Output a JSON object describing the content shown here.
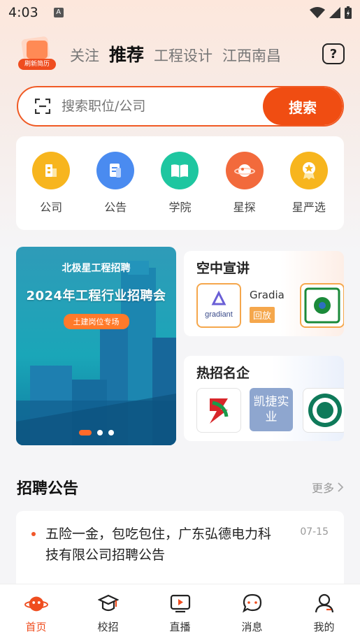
{
  "status_bar": {
    "time": "4:03",
    "a_icon": "A"
  },
  "header": {
    "badge_label": "刷新简历",
    "tabs": [
      "关注",
      "推荐",
      "工程设计",
      "江西南昌"
    ],
    "active_tab_index": 1,
    "help_icon": "?"
  },
  "search": {
    "placeholder": "搜索职位/公司",
    "button_label": "搜索"
  },
  "quick_links": [
    {
      "label": "公司",
      "icon": "building-icon",
      "color": "#f7b51e"
    },
    {
      "label": "公告",
      "icon": "notice-icon",
      "color": "#4a8bf0"
    },
    {
      "label": "学院",
      "icon": "book-icon",
      "color": "#1ec6a0"
    },
    {
      "label": "星探",
      "icon": "planet-icon",
      "color": "#f26a3c"
    },
    {
      "label": "星严选",
      "icon": "award-icon",
      "color": "#f7b51e"
    }
  ],
  "banner": {
    "brand": "北极星工程招聘",
    "title": "2024年工程行业招聘会",
    "tag": "土建岗位专场",
    "active_dot": 0,
    "dot_count": 3
  },
  "live_talk": {
    "title": "空中宣讲",
    "company_name": "Gradia",
    "status_tag": "回放",
    "logo_text": "gradiant"
  },
  "hot_companies": {
    "title": "热招名企",
    "kaijie_logo": "凯捷实业"
  },
  "announcements": {
    "title": "招聘公告",
    "more_label": "更多",
    "items": [
      {
        "text": "五险一金，包吃包住，广东弘德电力科技有限公司招聘公告",
        "date": "07-15"
      }
    ]
  },
  "bottom_nav": [
    {
      "label": "首页",
      "icon": "home-planet-icon",
      "active": true
    },
    {
      "label": "校招",
      "icon": "graduation-cap-icon",
      "active": false
    },
    {
      "label": "直播",
      "icon": "live-tv-icon",
      "active": false
    },
    {
      "label": "消息",
      "icon": "message-icon",
      "active": false
    },
    {
      "label": "我的",
      "icon": "profile-icon",
      "active": false
    }
  ],
  "colors": {
    "accent": "#ef4d1f",
    "banner": "#1aa6b8"
  }
}
